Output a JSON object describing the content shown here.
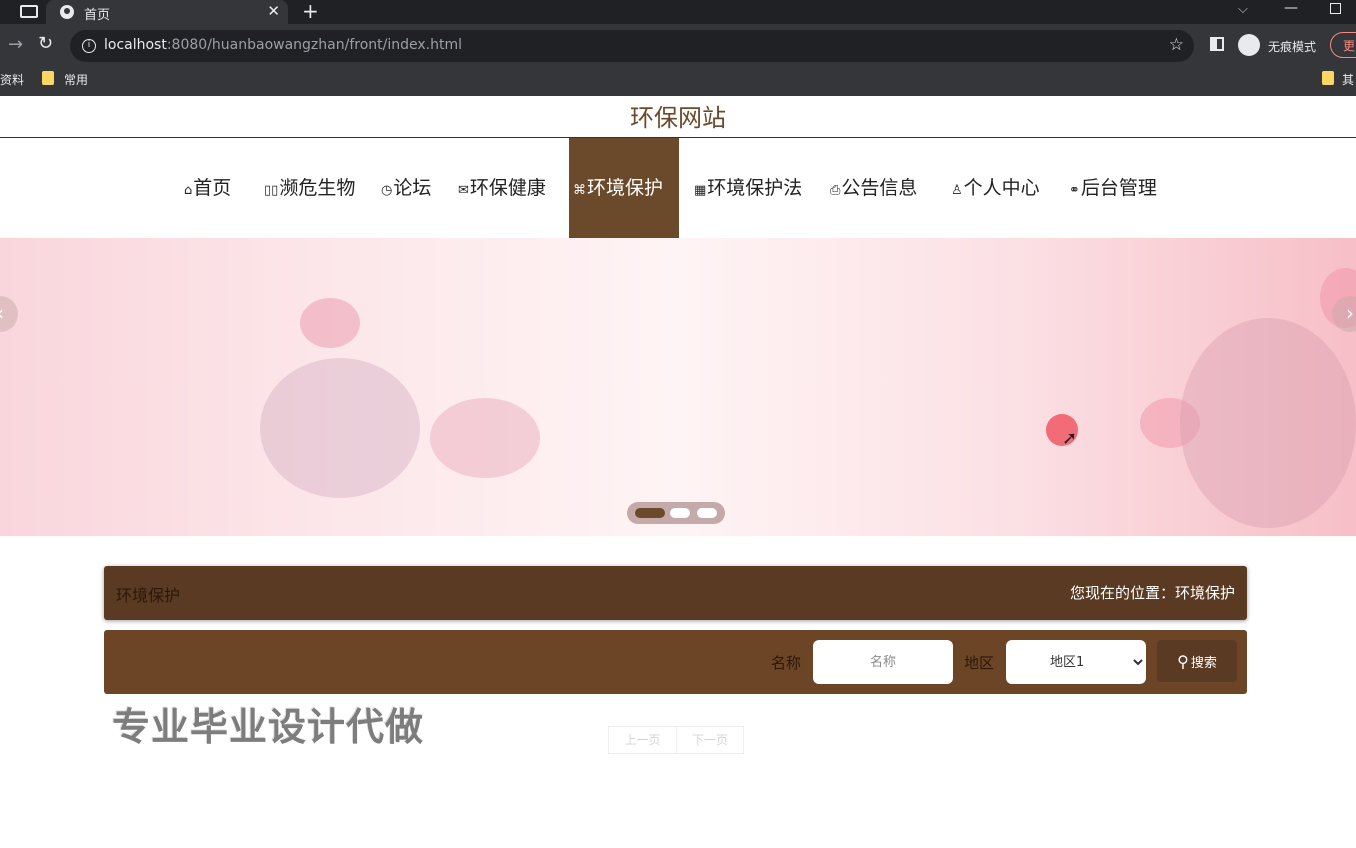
{
  "browser": {
    "tab_title": "首页",
    "url_host": "localhost",
    "url_rest": ":8080/huanbaowangzhan/front/index.html",
    "incognito_label": "无痕模式",
    "update_label": "更",
    "bookmarks": [
      "资料",
      "常用",
      "其"
    ]
  },
  "site": {
    "title": "环保网站"
  },
  "nav": {
    "items": [
      {
        "icon": "⌂",
        "label": "首页"
      },
      {
        "icon": "▯▯",
        "label": "濒危生物"
      },
      {
        "icon": "◷",
        "label": "论坛"
      },
      {
        "icon": "✉",
        "label": "环保健康"
      },
      {
        "icon": "⌘",
        "label": "环境保护"
      },
      {
        "icon": "▦",
        "label": "环境保护法"
      },
      {
        "icon": "⎙",
        "label": "公告信息"
      },
      {
        "icon": "♙",
        "label": "个人中心"
      },
      {
        "icon": "⚭",
        "label": "后台管理"
      }
    ],
    "active_index": 4
  },
  "carousel": {
    "prev": "‹",
    "next": "›",
    "active_slide": 1,
    "slide_count": 3
  },
  "section": {
    "title": "环境保护",
    "location": "您现在的位置：环境保护"
  },
  "search": {
    "name_label": "名称",
    "name_placeholder": "名称",
    "region_label": "地区",
    "region_selected": "地区1",
    "button_label": "搜索"
  },
  "watermark": "专业毕业设计代做",
  "pager": {
    "prev": "上一页",
    "next": "下一页"
  },
  "colors": {
    "accent": "#6b4a2b",
    "crumb_bg": "#5a3a22",
    "search_bg": "#6b4526"
  }
}
